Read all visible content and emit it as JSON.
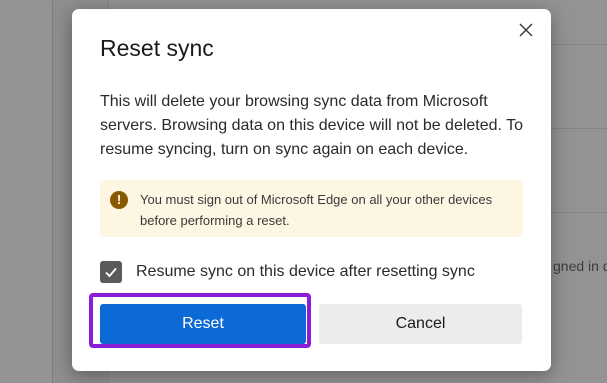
{
  "background": {
    "side_text": "gned in d"
  },
  "dialog": {
    "title": "Reset sync",
    "close_icon": "close-icon",
    "body": "This will delete your browsing sync data from Microsoft servers. Browsing data on this device will not be deleted. To resume syncing, turn on sync again on each device.",
    "warning": {
      "icon": "warning-icon",
      "icon_glyph": "!",
      "text": "You must sign out of Microsoft Edge on all your other devices before performing a reset."
    },
    "checkbox": {
      "checked": true,
      "label": "Resume sync on this device after resetting sync"
    },
    "buttons": {
      "reset": "Reset",
      "cancel": "Cancel"
    }
  },
  "colors": {
    "accent": "#0b6ad6",
    "highlight_frame": "#8a1ed6",
    "warning_bg": "#fdf6e3",
    "warning_icon": "#8a5a00",
    "overlay": "#8e8e8e"
  }
}
